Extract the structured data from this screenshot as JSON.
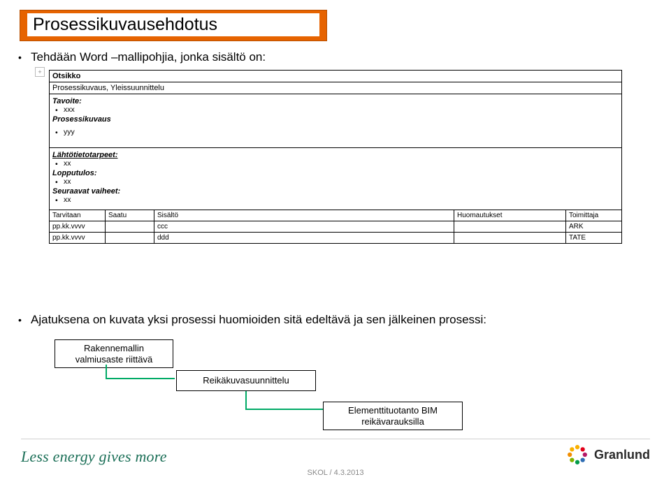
{
  "title": "Prosessikuvausehdotus",
  "bullets": {
    "b1": "Tehdään Word –mallipohjia, jonka sisältö on:",
    "b2": "Ajatuksena on kuvata yksi prosessi huomioiden sitä edeltävä ja sen jälkeinen prosessi:"
  },
  "word": {
    "marker": "+",
    "otsikko": "Otsikko",
    "header2": "Prosessikuvaus, Yleissuunnittelu",
    "tavoite_label": "Tavoite:",
    "tavoite_val": "xxx",
    "prosessikuvaus_label": "Prosessikuvaus",
    "prosessikuvaus_val": "yyy",
    "lahto_label": "Lähtötietotarpeet:",
    "lahto_val": "xx",
    "lopputulos_label": "Lopputulos:",
    "lopputulos_val": "xx",
    "seur_label": "Seuraavat vaiheet:",
    "seur_val": "xx",
    "table": {
      "h1": "Tarvitaan",
      "h2": "Saatu",
      "h3": "Sisältö",
      "h4": "Huomautukset",
      "h5": "Toimittaja",
      "rows": [
        {
          "c1": "pp.kk.vvvv",
          "c2": "",
          "c3": "ccc",
          "c4": "",
          "c5": "ARK"
        },
        {
          "c1": "pp.kk.vvvv",
          "c2": "",
          "c3": "ddd",
          "c4": "",
          "c5": "TATE"
        }
      ]
    }
  },
  "flow": {
    "box1a": "Rakennemallin",
    "box1b": "valmiusaste riittävä",
    "box2": "Reikäkuvasuunnittelu",
    "box3a": "Elementtituotanto BIM",
    "box3b": "reikävarauksilla"
  },
  "footer": {
    "slogan": "Less energy gives more",
    "center": "SKOL / 4.3.2013",
    "brand": "Granlund"
  }
}
